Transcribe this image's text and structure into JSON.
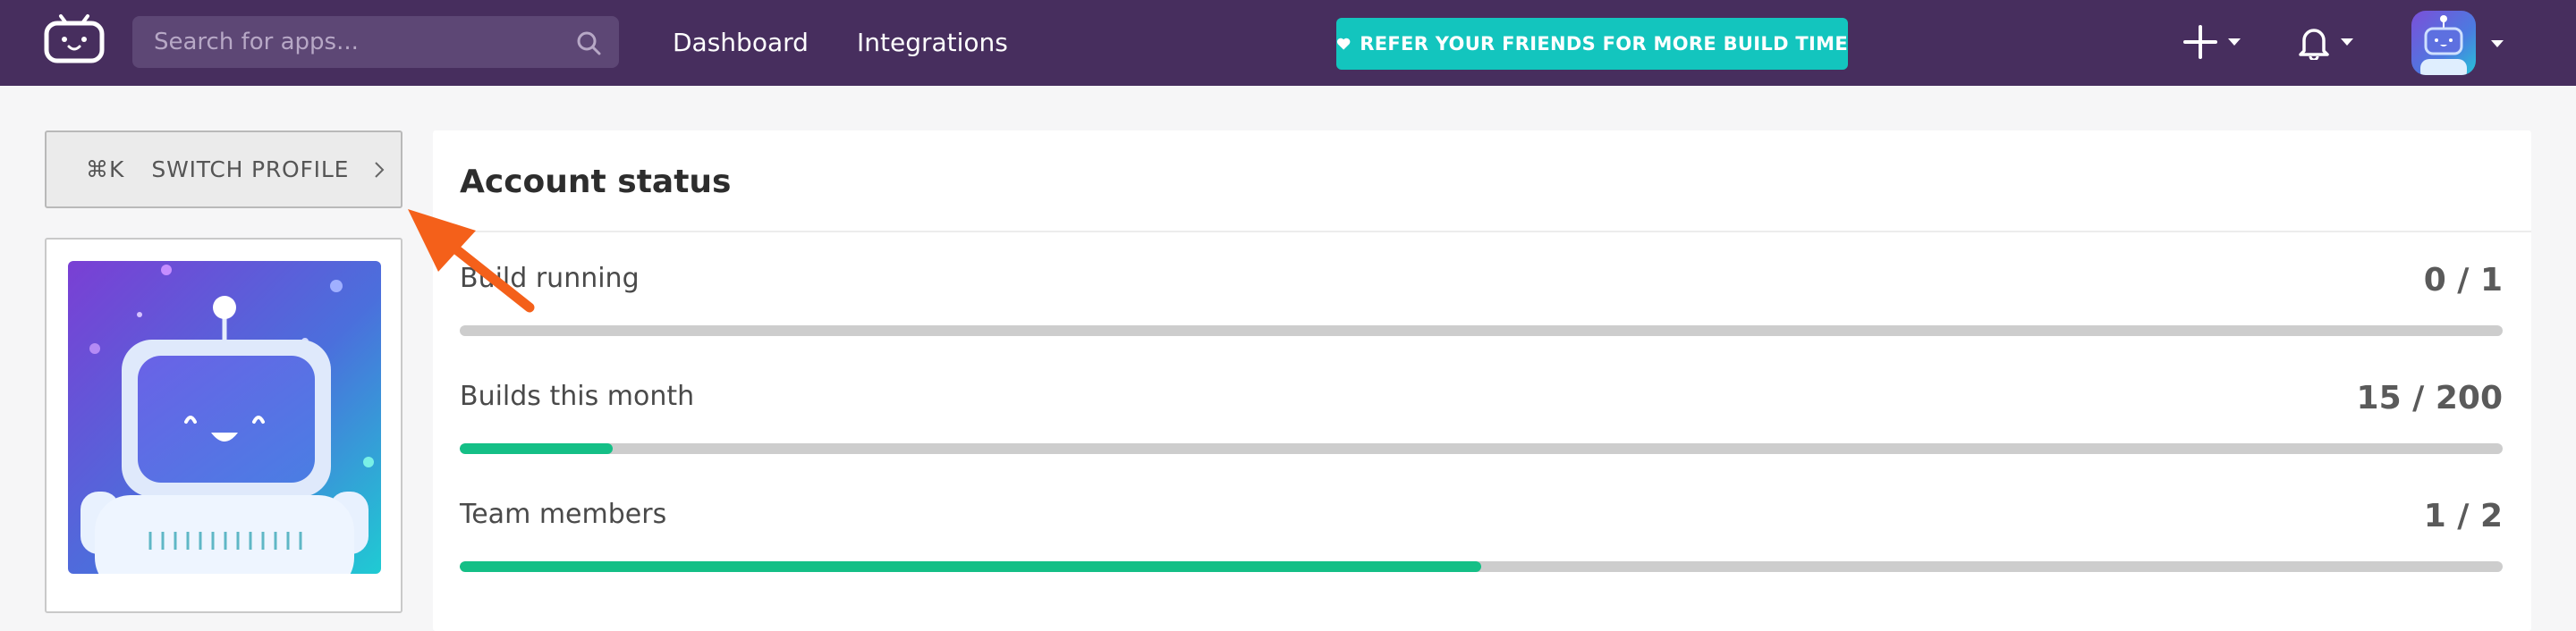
{
  "header": {
    "search": {
      "placeholder": "Search for apps..."
    },
    "nav": [
      {
        "label": "Dashboard"
      },
      {
        "label": "Integrations"
      }
    ],
    "refer_banner": {
      "prefix": "REFER YOUR FRIENDS FOR",
      "highlight": "MORE BUILD TIME"
    },
    "icons": {
      "logo": "bitrise-robot-logo-icon",
      "search": "search-icon",
      "add": "plus-icon",
      "notifications": "bell-icon",
      "dropdown": "chevron-down-icon"
    }
  },
  "sidebar": {
    "switch_profile": {
      "shortcut": "⌘K",
      "label": "SWITCH PROFILE"
    }
  },
  "account_status": {
    "title": "Account status",
    "rows": [
      {
        "label": "Build running",
        "value": "0 / 1",
        "fraction": 0
      },
      {
        "label": "Builds this month",
        "value": "15 / 200",
        "fraction": 0.075
      },
      {
        "label": "Team members",
        "value": "1 / 2",
        "fraction": 0.5
      }
    ]
  },
  "colors": {
    "header_bg": "#472e5e",
    "accent_teal": "#13c5be",
    "progress_green": "#14bf86",
    "annotation_orange": "#f4601a"
  }
}
